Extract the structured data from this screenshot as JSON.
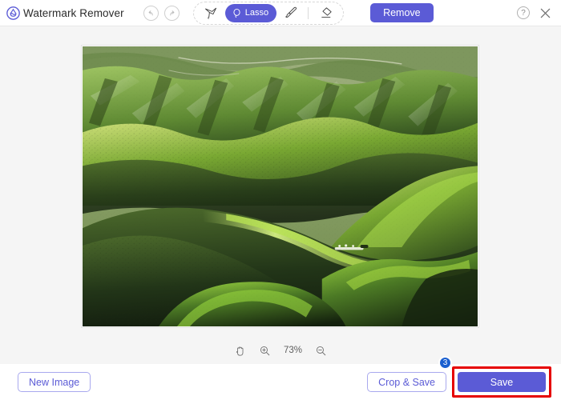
{
  "app": {
    "title": "Watermark Remover",
    "logo_icon": "waterdrop-wave-logo"
  },
  "header": {
    "undo": {
      "label": "Undo",
      "icon": "undo-arrow-icon",
      "enabled": false
    },
    "redo": {
      "label": "Redo",
      "icon": "redo-arrow-icon",
      "enabled": false
    },
    "tools": [
      {
        "id": "polygonal-lasso",
        "label": "Polygonal Lasso",
        "icon": "polygonal-lasso-icon",
        "active": false
      },
      {
        "id": "lasso",
        "label": "Lasso",
        "icon": "lasso-icon",
        "active": true
      },
      {
        "id": "brush",
        "label": "Brush",
        "icon": "brush-icon",
        "active": false
      },
      {
        "id": "eraser",
        "label": "Eraser",
        "icon": "eraser-icon",
        "active": false
      }
    ],
    "remove_button": "Remove",
    "help_icon": "question-mark-icon",
    "help_label": "?",
    "close_icon": "close-x-icon"
  },
  "canvas": {
    "image_alt": "Aerial photo of rolling green hills",
    "zoom": {
      "hand_icon": "hand-tool-icon",
      "zoom_in_icon": "zoom-in-icon",
      "zoom_out_icon": "zoom-out-icon",
      "level": "73%"
    }
  },
  "footer": {
    "new_image": "New Image",
    "crop_and_save": "Crop & Save",
    "save": "Save",
    "annotation": {
      "step_number": "3",
      "highlight_color": "#e60000",
      "badge_color": "#1a5fd0"
    }
  },
  "colors": {
    "accent": "#5b5bd6",
    "canvas_bg": "#f5f5f5",
    "header_bg": "#ffffff"
  }
}
